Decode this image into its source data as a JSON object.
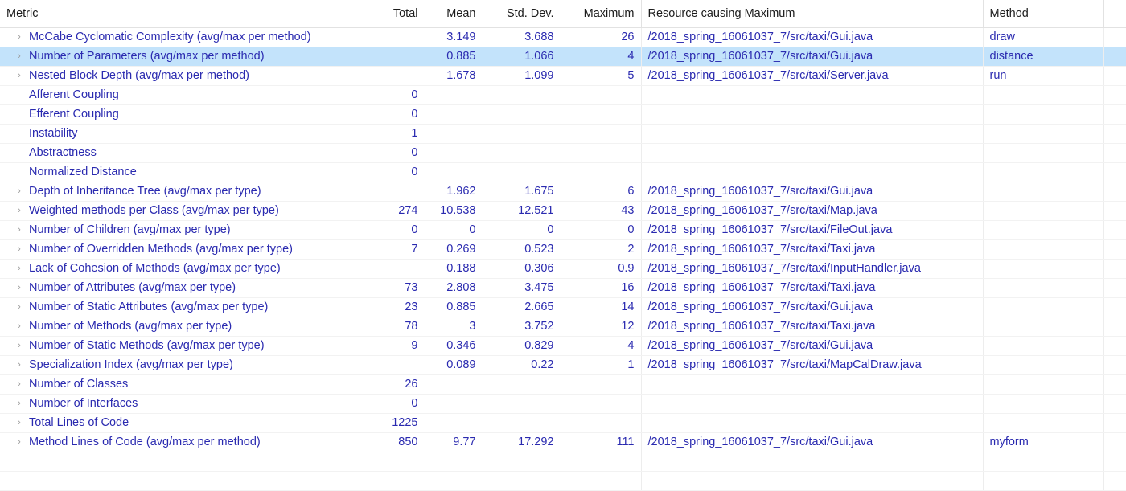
{
  "table": {
    "columns": [
      {
        "key": "metric",
        "label": "Metric",
        "align": "left"
      },
      {
        "key": "total",
        "label": "Total",
        "align": "right"
      },
      {
        "key": "mean",
        "label": "Mean",
        "align": "right"
      },
      {
        "key": "stddev",
        "label": "Std. Dev.",
        "align": "right"
      },
      {
        "key": "maximum",
        "label": "Maximum",
        "align": "right"
      },
      {
        "key": "resource",
        "label": "Resource causing Maximum",
        "align": "left"
      },
      {
        "key": "method",
        "label": "Method",
        "align": "left"
      }
    ],
    "colors": {
      "text_blue": "#2a2ab0",
      "text_red": "#d93b3b",
      "selected_row": "#c3e3fb",
      "header_text": "#1c1c1c",
      "grid_line": "#ededed",
      "twisty": "#9a9a9a"
    },
    "expand_icon": "chevron-right-icon",
    "expand_glyph": "›",
    "rows": [
      {
        "expandable": true,
        "style": "red",
        "selected": false,
        "metric": "McCabe Cyclomatic Complexity (avg/max per method)",
        "total": "",
        "mean": "3.149",
        "stddev": "3.688",
        "maximum": "26",
        "resource": "/2018_spring_16061037_7/src/taxi/Gui.java",
        "method": "draw"
      },
      {
        "expandable": true,
        "style": "blue",
        "selected": true,
        "metric": "Number of Parameters (avg/max per method)",
        "total": "",
        "mean": "0.885",
        "stddev": "1.066",
        "maximum": "4",
        "resource": "/2018_spring_16061037_7/src/taxi/Gui.java",
        "method": "distance"
      },
      {
        "expandable": true,
        "style": "blue",
        "selected": false,
        "metric": "Nested Block Depth (avg/max per method)",
        "total": "",
        "mean": "1.678",
        "stddev": "1.099",
        "maximum": "5",
        "resource": "/2018_spring_16061037_7/src/taxi/Server.java",
        "method": "run"
      },
      {
        "expandable": false,
        "style": "blue",
        "selected": false,
        "metric": "Afferent Coupling",
        "total": "0",
        "mean": "",
        "stddev": "",
        "maximum": "",
        "resource": "",
        "method": ""
      },
      {
        "expandable": false,
        "style": "blue",
        "selected": false,
        "metric": "Efferent Coupling",
        "total": "0",
        "mean": "",
        "stddev": "",
        "maximum": "",
        "resource": "",
        "method": ""
      },
      {
        "expandable": false,
        "style": "blue",
        "selected": false,
        "metric": "Instability",
        "total": "1",
        "mean": "",
        "stddev": "",
        "maximum": "",
        "resource": "",
        "method": ""
      },
      {
        "expandable": false,
        "style": "blue",
        "selected": false,
        "metric": "Abstractness",
        "total": "0",
        "mean": "",
        "stddev": "",
        "maximum": "",
        "resource": "",
        "method": ""
      },
      {
        "expandable": false,
        "style": "blue",
        "selected": false,
        "metric": "Normalized Distance",
        "total": "0",
        "mean": "",
        "stddev": "",
        "maximum": "",
        "resource": "",
        "method": ""
      },
      {
        "expandable": true,
        "style": "blue",
        "selected": false,
        "metric": "Depth of Inheritance Tree (avg/max per type)",
        "total": "",
        "mean": "1.962",
        "stddev": "1.675",
        "maximum": "6",
        "resource": "/2018_spring_16061037_7/src/taxi/Gui.java",
        "method": ""
      },
      {
        "expandable": true,
        "style": "blue",
        "selected": false,
        "metric": "Weighted methods per Class (avg/max per type)",
        "total": "274",
        "mean": "10.538",
        "stddev": "12.521",
        "maximum": "43",
        "resource": "/2018_spring_16061037_7/src/taxi/Map.java",
        "method": ""
      },
      {
        "expandable": true,
        "style": "blue",
        "selected": false,
        "metric": "Number of Children (avg/max per type)",
        "total": "0",
        "mean": "0",
        "stddev": "0",
        "maximum": "0",
        "resource": "/2018_spring_16061037_7/src/taxi/FileOut.java",
        "method": ""
      },
      {
        "expandable": true,
        "style": "blue",
        "selected": false,
        "metric": "Number of Overridden Methods (avg/max per type)",
        "total": "7",
        "mean": "0.269",
        "stddev": "0.523",
        "maximum": "2",
        "resource": "/2018_spring_16061037_7/src/taxi/Taxi.java",
        "method": ""
      },
      {
        "expandable": true,
        "style": "blue",
        "selected": false,
        "metric": "Lack of Cohesion of Methods (avg/max per type)",
        "total": "",
        "mean": "0.188",
        "stddev": "0.306",
        "maximum": "0.9",
        "resource": "/2018_spring_16061037_7/src/taxi/InputHandler.java",
        "method": ""
      },
      {
        "expandable": true,
        "style": "blue",
        "selected": false,
        "metric": "Number of Attributes (avg/max per type)",
        "total": "73",
        "mean": "2.808",
        "stddev": "3.475",
        "maximum": "16",
        "resource": "/2018_spring_16061037_7/src/taxi/Taxi.java",
        "method": ""
      },
      {
        "expandable": true,
        "style": "blue",
        "selected": false,
        "metric": "Number of Static Attributes (avg/max per type)",
        "total": "23",
        "mean": "0.885",
        "stddev": "2.665",
        "maximum": "14",
        "resource": "/2018_spring_16061037_7/src/taxi/Gui.java",
        "method": ""
      },
      {
        "expandable": true,
        "style": "blue",
        "selected": false,
        "metric": "Number of Methods (avg/max per type)",
        "total": "78",
        "mean": "3",
        "stddev": "3.752",
        "maximum": "12",
        "resource": "/2018_spring_16061037_7/src/taxi/Taxi.java",
        "method": ""
      },
      {
        "expandable": true,
        "style": "blue",
        "selected": false,
        "metric": "Number of Static Methods (avg/max per type)",
        "total": "9",
        "mean": "0.346",
        "stddev": "0.829",
        "maximum": "4",
        "resource": "/2018_spring_16061037_7/src/taxi/Gui.java",
        "method": ""
      },
      {
        "expandable": true,
        "style": "blue",
        "selected": false,
        "metric": "Specialization Index (avg/max per type)",
        "total": "",
        "mean": "0.089",
        "stddev": "0.22",
        "maximum": "1",
        "resource": "/2018_spring_16061037_7/src/taxi/MapCalDraw.java",
        "method": ""
      },
      {
        "expandable": true,
        "style": "blue",
        "selected": false,
        "metric": "Number of Classes",
        "total": "26",
        "mean": "",
        "stddev": "",
        "maximum": "",
        "resource": "",
        "method": ""
      },
      {
        "expandable": true,
        "style": "blue",
        "selected": false,
        "metric": "Number of Interfaces",
        "total": "0",
        "mean": "",
        "stddev": "",
        "maximum": "",
        "resource": "",
        "method": ""
      },
      {
        "expandable": true,
        "style": "blue",
        "selected": false,
        "metric": "Total Lines of Code",
        "total": "1225",
        "mean": "",
        "stddev": "",
        "maximum": "",
        "resource": "",
        "method": ""
      },
      {
        "expandable": true,
        "style": "blue",
        "selected": false,
        "metric": "Method Lines of Code (avg/max per method)",
        "total": "850",
        "mean": "9.77",
        "stddev": "17.292",
        "maximum": "111",
        "resource": "/2018_spring_16061037_7/src/taxi/Gui.java",
        "method": "myform"
      },
      {
        "expandable": false,
        "style": "blue",
        "selected": false,
        "empty": true,
        "metric": "",
        "total": "",
        "mean": "",
        "stddev": "",
        "maximum": "",
        "resource": "",
        "method": ""
      },
      {
        "expandable": false,
        "style": "blue",
        "selected": false,
        "empty": true,
        "metric": "",
        "total": "",
        "mean": "",
        "stddev": "",
        "maximum": "",
        "resource": "",
        "method": ""
      }
    ]
  }
}
